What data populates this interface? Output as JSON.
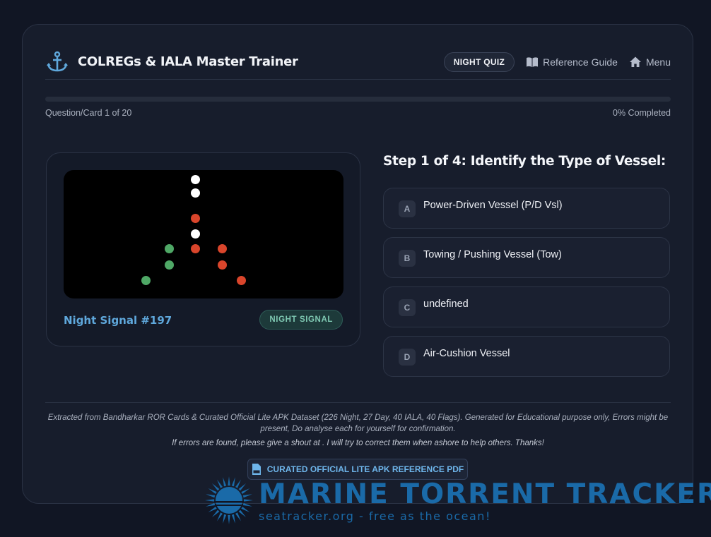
{
  "header": {
    "app_title": "COLREGs & IALA Master Trainer",
    "mode_pill": "NIGHT QUIZ",
    "reference_label": "Reference Guide",
    "menu_label": "Menu"
  },
  "progress": {
    "question_label": "Question/Card 1 of 20",
    "completed_label": "0% Completed",
    "completed_fraction": 0
  },
  "signal": {
    "name": "Night Signal #197",
    "badge": "NIGHT SIGNAL",
    "lights": [
      "white",
      "white",
      "red",
      "white",
      "red",
      "red",
      "green",
      "green",
      "red",
      "green",
      "red"
    ]
  },
  "question": {
    "title": "Step 1 of 4: Identify the Type of Vessel:",
    "options": [
      {
        "key": "A",
        "text": "Power-Driven Vessel (P/D Vsl)"
      },
      {
        "key": "B",
        "text": "Towing / Pushing Vessel (Tow)"
      },
      {
        "key": "C",
        "text": "undefined"
      },
      {
        "key": "D",
        "text": "Air-Cushion Vessel"
      }
    ]
  },
  "footer": {
    "disclaimer": "Extracted from Bandharkar ROR Cards & Curated Official Lite APK Dataset (226 Night, 27 Day, 40 IALA, 40 Flags). Generated for Educational purpose only, Errors might be present, Do analyse each for yourself for confirmation.",
    "note": "If errors are found, please give a shout at . I will try to correct them when ashore to help others. Thanks!",
    "pdf_button": "CURATED OFFICIAL LITE APK REFERENCE PDF"
  },
  "watermark": {
    "title": "MARINE TORRENT TRACKER",
    "subtitle": "seatracker.org - free as the ocean!"
  },
  "colors": {
    "accent": "#2f8fd6",
    "signal_name": "#5fa8dc",
    "light_white": "#ffffff",
    "light_red": "#d9452b",
    "light_green": "#4fa866"
  },
  "icons": [
    "anchor-icon",
    "book-icon",
    "home-icon",
    "pdf-icon",
    "sun-icon"
  ]
}
